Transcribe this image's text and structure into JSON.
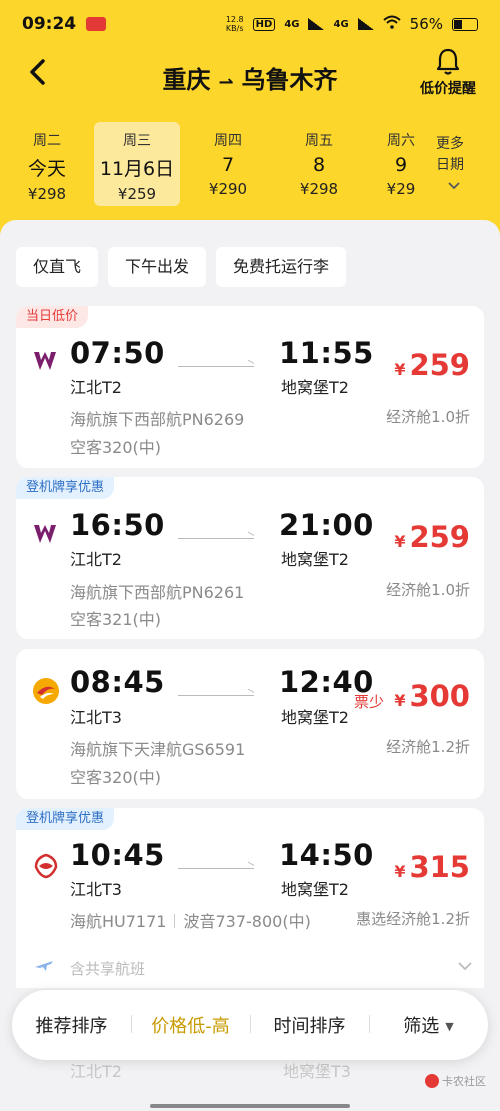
{
  "status_bar": {
    "time": "09:24",
    "net_speed": "12.8",
    "net_unit": "KB/s",
    "hd": "HD",
    "sig1": "4G",
    "sig2": "4G",
    "battery": "56%"
  },
  "header": {
    "from": "重庆",
    "arrow": "⇀",
    "to": "乌鲁木齐",
    "alert_label": "低价提醒"
  },
  "dates": [
    {
      "weekday": "周二",
      "date": "今天",
      "price": "¥298"
    },
    {
      "weekday": "周三",
      "date": "11月6日",
      "price": "¥259"
    },
    {
      "weekday": "周四",
      "date": "7",
      "price": "¥290"
    },
    {
      "weekday": "周五",
      "date": "8",
      "price": "¥298"
    },
    {
      "weekday": "周六",
      "date": "9",
      "price": "¥29"
    }
  ],
  "more_dates": {
    "line1": "更多",
    "line2": "日期"
  },
  "filters": [
    "仅直飞",
    "下午出发",
    "免费托运行李"
  ],
  "flights": [
    {
      "tag": "当日低价",
      "dep_time": "07:50",
      "dep_term": "江北T2",
      "arr_time": "11:55",
      "arr_term": "地窝堡T2",
      "currency": "¥",
      "price": "259",
      "scarce": "",
      "info1": "海航旗下西部航PN6269",
      "info2": "空客320(中)",
      "cabin": "经济舱1.0折"
    },
    {
      "tag": "登机牌享优惠",
      "dep_time": "16:50",
      "dep_term": "江北T2",
      "arr_time": "21:00",
      "arr_term": "地窝堡T2",
      "currency": "¥",
      "price": "259",
      "scarce": "",
      "info1": "海航旗下西部航PN6261",
      "info2": "空客321(中)",
      "cabin": "经济舱1.0折"
    },
    {
      "tag": "",
      "dep_time": "08:45",
      "dep_term": "江北T3",
      "arr_time": "12:40",
      "arr_term": "地窝堡T2",
      "currency": "¥",
      "price": "300",
      "scarce": "票少",
      "info1": "海航旗下天津航GS6591",
      "info2": "空客320(中)",
      "cabin": "经济舱1.2折"
    },
    {
      "tag": "登机牌享优惠",
      "dep_time": "10:45",
      "dep_term": "江北T3",
      "arr_time": "14:50",
      "arr_term": "地窝堡T2",
      "currency": "¥",
      "price": "315",
      "scarce": "",
      "info1": "海航HU7171",
      "info1b": "波音737-800(中)",
      "info2": "",
      "cabin": "惠选经济舱1.2折"
    }
  ],
  "codeshare": "含共享航班",
  "ghost": {
    "dep_term": "江北T2",
    "arr_term": "地窝堡T3"
  },
  "sort": {
    "recommend": "推荐排序",
    "price": "价格低-高",
    "time": "时间排序",
    "filter": "筛选"
  },
  "watermark": "卡农社区",
  "colors": {
    "brand_yellow": "#fdd62c",
    "price_red": "#e53935",
    "active_sort": "#c99a00"
  }
}
